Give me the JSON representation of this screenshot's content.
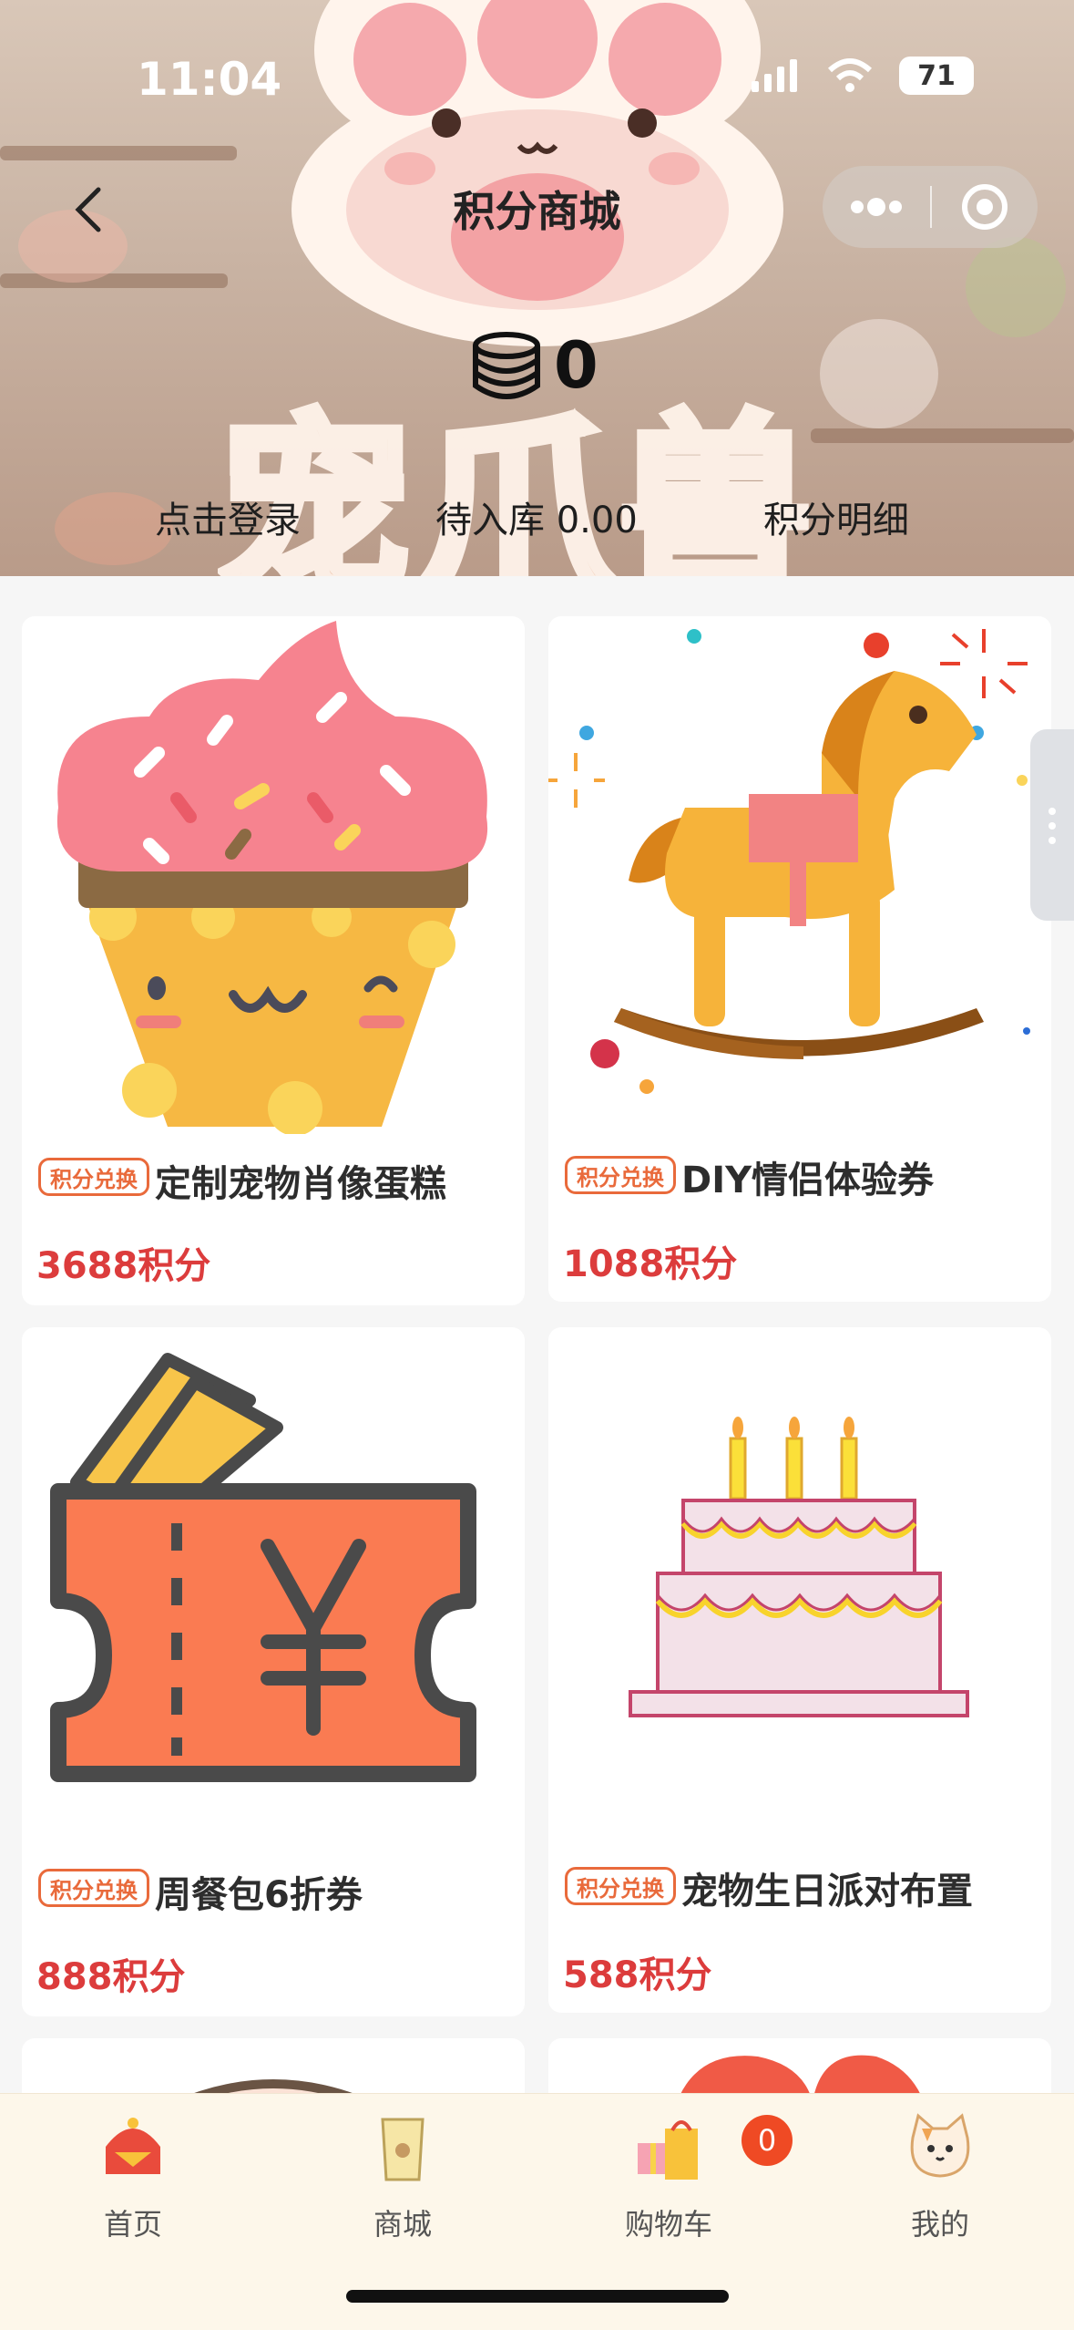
{
  "status": {
    "time": "11:04",
    "battery": "71"
  },
  "nav": {
    "title": "积分商城"
  },
  "header": {
    "brand": "宠爪兽",
    "points": "0",
    "login": "点击登录",
    "pending": "待入库 0.00",
    "detail": "积分明细"
  },
  "products": [
    {
      "tag": "积分兑换",
      "name": "定制宠物肖像蛋糕",
      "price": "3688积分"
    },
    {
      "tag": "积分兑换",
      "name": "DIY情侣体验券",
      "price": "1088积分"
    },
    {
      "tag": "积分兑换",
      "name": "周餐包6折券",
      "price": "888积分"
    },
    {
      "tag": "积分兑换",
      "name": "宠物生日派对布置",
      "price": "588积分"
    }
  ],
  "tabbar": {
    "items": [
      {
        "label": "首页",
        "icon": "home-icon"
      },
      {
        "label": "商城",
        "icon": "shop-icon"
      },
      {
        "label": "购物车",
        "icon": "cart-icon"
      },
      {
        "label": "我的",
        "icon": "profile-icon"
      }
    ],
    "cart_badge": "0"
  },
  "colors": {
    "price": "#dc3c3c",
    "tag": "#e96a3b",
    "tabbar_bg": "#fdf7ea"
  }
}
